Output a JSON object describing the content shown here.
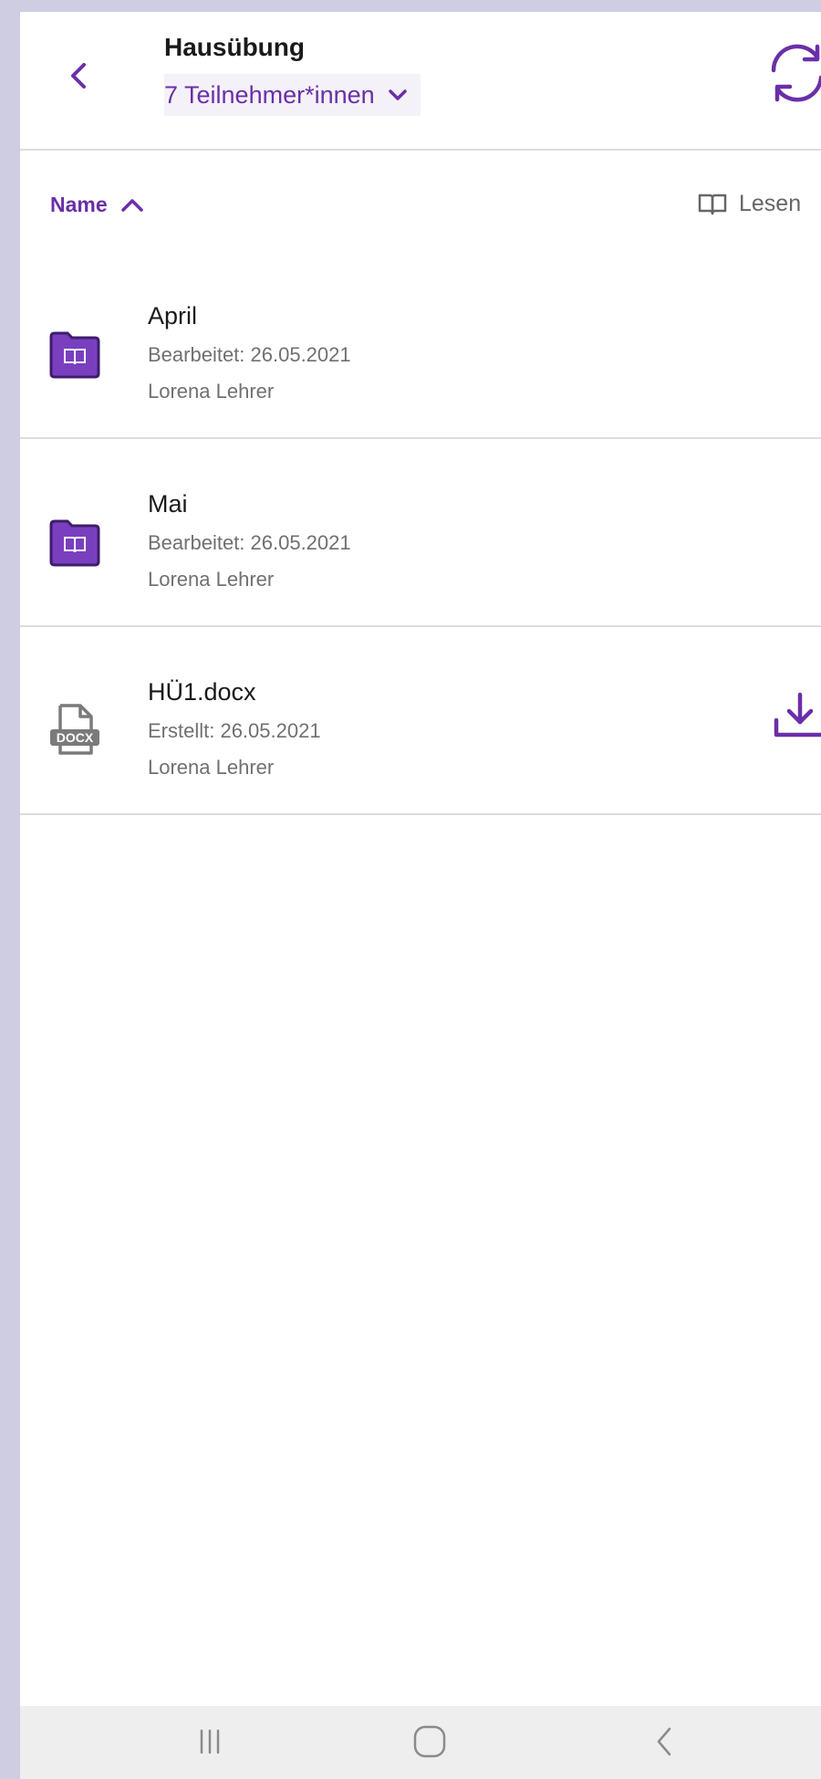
{
  "header": {
    "title": "Hausübung",
    "participants_label": "7 Teilnehmer*innen",
    "back_icon": "chevron-left-icon",
    "sync_icon": "sync-icon"
  },
  "sort": {
    "label": "Name",
    "direction": "ascending",
    "read_label": "Lesen",
    "read_icon": "book-open-icon"
  },
  "items": [
    {
      "name": "April",
      "meta": "Bearbeitet: 26.05.2021",
      "owner": "Lorena Lehrer",
      "icon": "folder-book-icon"
    },
    {
      "name": "Mai",
      "meta": "Bearbeitet: 26.05.2021",
      "owner": "Lorena Lehrer",
      "icon": "folder-book-icon"
    },
    {
      "name": "HÜ1.docx",
      "meta": "Erstellt: 26.05.2021",
      "owner": "Lorena Lehrer",
      "icon": "docx-file-icon",
      "action_icon": "download-icon"
    }
  ],
  "navbar": {
    "icons": [
      "recent-apps-icon",
      "home-icon",
      "back-icon"
    ]
  },
  "colors": {
    "accent": "#6a2fa8",
    "folder": "#7a3fbf",
    "background": "#cfcde2"
  }
}
